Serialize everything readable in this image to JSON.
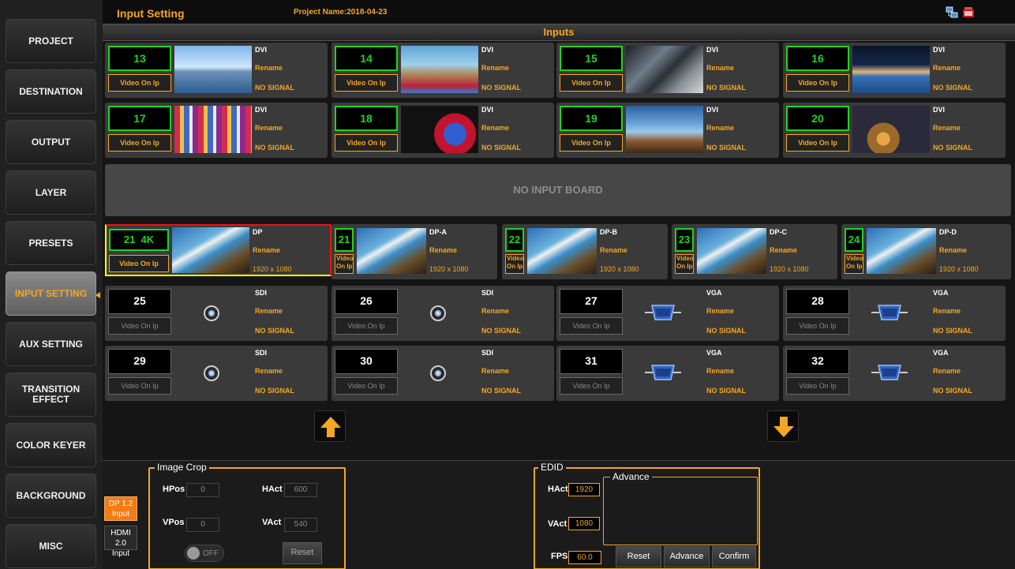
{
  "sidebar": {
    "items": [
      {
        "label": "PROJECT"
      },
      {
        "label": "DESTINATION"
      },
      {
        "label": "OUTPUT"
      },
      {
        "label": "LAYER"
      },
      {
        "label": "PRESETS"
      },
      {
        "label": "INPUT SETTING"
      },
      {
        "label": "AUX SETTING"
      },
      {
        "label": "TRANSITION EFFECT"
      },
      {
        "label": "COLOR KEYER"
      },
      {
        "label": "BACKGROUND"
      },
      {
        "label": "MISC"
      }
    ],
    "active": "INPUT SETTING"
  },
  "topbar": {
    "title": "Input Setting",
    "project_name": "Project Name:2018-04-23",
    "icons": [
      "network-icon",
      "record-icon"
    ]
  },
  "inputs_header": "Inputs",
  "video_label": "Video On Ip",
  "rename_label": "Rename",
  "no_signal": "NO SIGNAL",
  "row1": [
    {
      "num": "13",
      "type": "DVI"
    },
    {
      "num": "14",
      "type": "DVI"
    },
    {
      "num": "15",
      "type": "DVI"
    },
    {
      "num": "16",
      "type": "DVI"
    }
  ],
  "row2": [
    {
      "num": "17",
      "type": "DVI"
    },
    {
      "num": "18",
      "type": "DVI"
    },
    {
      "num": "19",
      "type": "DVI"
    },
    {
      "num": "20",
      "type": "DVI"
    }
  ],
  "no_input_board": "NO INPUT BOARD",
  "dp_main": {
    "num": "21  4K",
    "type": "DP",
    "resolution": "1920 x 1080"
  },
  "dp_subs": [
    {
      "num": "21",
      "type": "DP-A",
      "resolution": "1920 x 1080",
      "video": "Video On Ip"
    },
    {
      "num": "22",
      "type": "DP-B",
      "resolution": "1920 x 1080",
      "video": "Video On Ip"
    },
    {
      "num": "23",
      "type": "DP-C",
      "resolution": "1920 x 1080",
      "video": "Video On Ip"
    },
    {
      "num": "24",
      "type": "DP-D",
      "resolution": "1920 x 1080",
      "video": "Video On Ip"
    }
  ],
  "row4": [
    {
      "num": "25",
      "type": "SDI"
    },
    {
      "num": "26",
      "type": "SDI"
    },
    {
      "num": "27",
      "type": "VGA"
    },
    {
      "num": "28",
      "type": "VGA"
    }
  ],
  "row5": [
    {
      "num": "29",
      "type": "SDI"
    },
    {
      "num": "30",
      "type": "SDI"
    },
    {
      "num": "31",
      "type": "VGA"
    },
    {
      "num": "32",
      "type": "VGA"
    }
  ],
  "nav": {
    "up_icon": "arrow-up-icon",
    "down_icon": "arrow-down-icon"
  },
  "bottom": {
    "tabs": [
      {
        "label1": "DP 1.2",
        "label2": "Input"
      },
      {
        "label1": "HDMI 2.0",
        "label2": "Input"
      }
    ],
    "image_crop": {
      "title": "Image Crop",
      "hpos_label": "HPos",
      "hpos": "0",
      "hact_label": "HAct",
      "hact": "600",
      "vpos_label": "VPos",
      "vpos": "0",
      "vact_label": "VAct",
      "vact": "540",
      "toggle": "OFF",
      "reset": "Reset"
    },
    "edid": {
      "title": "EDID",
      "hact_label": "HAct",
      "hact": "1920",
      "vact_label": "VAct",
      "vact": "1080",
      "fps_label": "FPS",
      "fps": "60.0",
      "advance_title": "Advance",
      "reset": "Reset",
      "advance": "Advance",
      "confirm": "Confirm"
    }
  },
  "colors": {
    "accent": "#f5a623",
    "active_green": "#1fd420",
    "background": "#151515"
  }
}
